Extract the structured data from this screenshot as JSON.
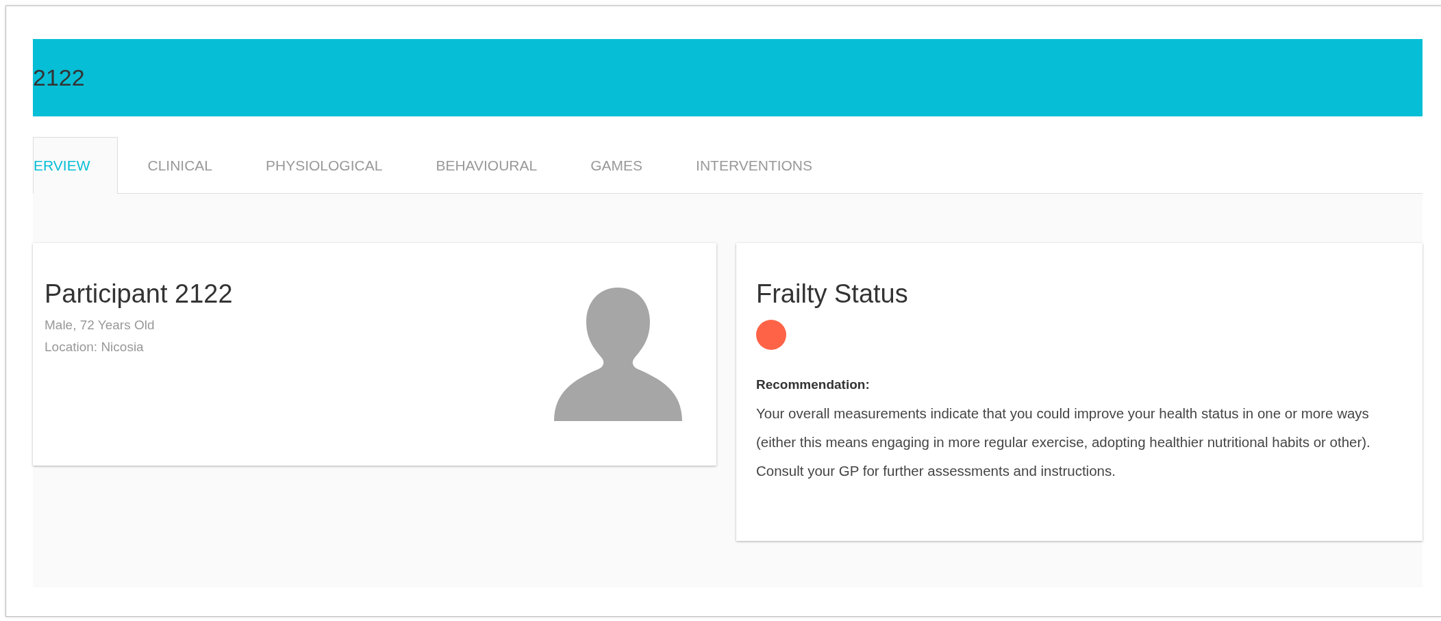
{
  "header": {
    "title": "2122"
  },
  "tabs": [
    {
      "label": "ERVIEW",
      "selected": true
    },
    {
      "label": "CLINICAL",
      "selected": false
    },
    {
      "label": "PHYSIOLOGICAL",
      "selected": false
    },
    {
      "label": "BEHAVIOURAL",
      "selected": false
    },
    {
      "label": "GAMES",
      "selected": false
    },
    {
      "label": "INTERVENTIONS",
      "selected": false
    }
  ],
  "participant_card": {
    "title": "Participant 2122",
    "details": [
      "Male, 72 Years Old",
      "Location: Nicosia"
    ]
  },
  "frailty_card": {
    "title": "Frailty Status",
    "status": {
      "color": "#ff6347"
    },
    "recommendation_label": "Recommendation:",
    "recommendation": "Your overall measurements indicate that you could improve your health status in one or more ways (either this means engaging in more regular exercise, adopting healthier nutritional habits or other). Consult your GP for further assessments and instructions."
  }
}
